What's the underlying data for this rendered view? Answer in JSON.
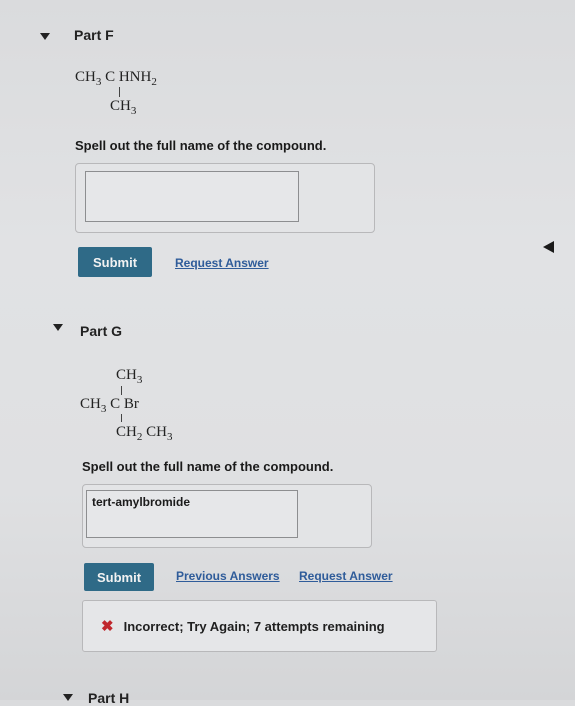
{
  "part_f": {
    "title": "Part F",
    "formula": {
      "main": [
        "CH",
        "3",
        " C HNH",
        "2"
      ],
      "branch": [
        "CH",
        "3"
      ]
    },
    "prompt": "Spell out the full name of the compound.",
    "input_value": "",
    "submit_label": "Submit",
    "request_answer_label": "Request Answer"
  },
  "part_g": {
    "title": "Part G",
    "formula": {
      "top": [
        "CH",
        "3"
      ],
      "middle": [
        "CH",
        "3",
        " C Br"
      ],
      "bottom": [
        "CH",
        "2",
        " CH",
        "3"
      ]
    },
    "prompt": "Spell out the full name of the compound.",
    "input_value": "tert-amylbromide",
    "submit_label": "Submit",
    "previous_answers_label": "Previous Answers",
    "request_answer_label": "Request Answer",
    "feedback": {
      "icon": "x-icon",
      "text": "Incorrect; Try Again; 7 attempts remaining",
      "color": "#c0272d"
    }
  },
  "part_h": {
    "title": "Part H"
  },
  "colors": {
    "submit_bg": "#2f6a87",
    "link": "#2f5c9a"
  }
}
